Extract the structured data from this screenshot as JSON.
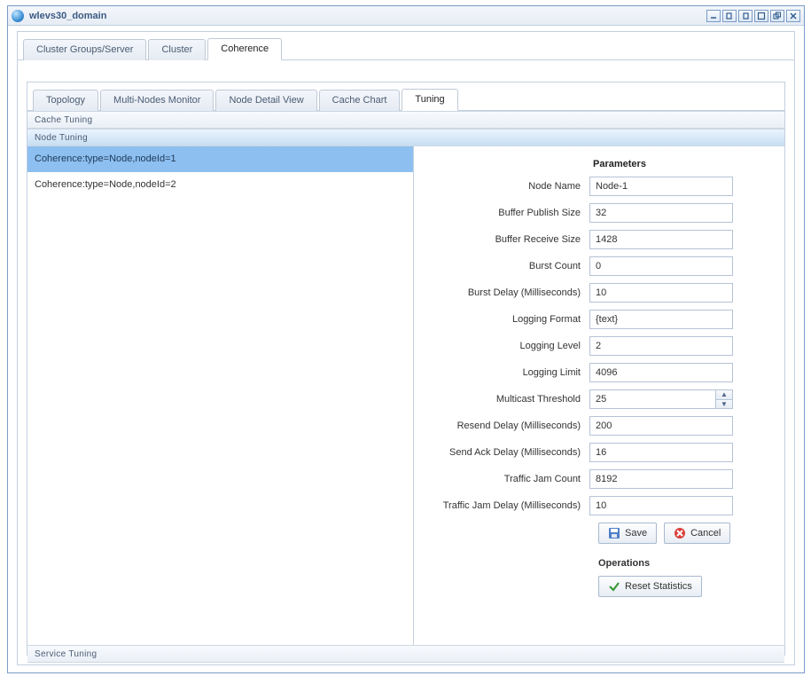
{
  "window": {
    "title": "wlevs30_domain"
  },
  "primary_tabs": [
    {
      "label": "Cluster Groups/Server",
      "active": false
    },
    {
      "label": "Cluster",
      "active": false
    },
    {
      "label": "Coherence",
      "active": true
    }
  ],
  "secondary_tabs": [
    {
      "label": "Topology",
      "active": false
    },
    {
      "label": "Multi-Nodes Monitor",
      "active": false
    },
    {
      "label": "Node Detail View",
      "active": false
    },
    {
      "label": "Cache Chart",
      "active": false
    },
    {
      "label": "Tuning",
      "active": true
    }
  ],
  "accordion": {
    "cache": "Cache Tuning",
    "node": "Node Tuning",
    "service": "Service Tuning"
  },
  "nodes": [
    {
      "label": "Coherence:type=Node,nodeId=1",
      "selected": true
    },
    {
      "label": "Coherence:type=Node,nodeId=2",
      "selected": false
    }
  ],
  "form": {
    "heading": "Parameters",
    "fields": {
      "node_name": {
        "label": "Node Name",
        "value": "Node-1"
      },
      "buffer_publish_size": {
        "label": "Buffer Publish Size",
        "value": "32"
      },
      "buffer_receive_size": {
        "label": "Buffer Receive Size",
        "value": "1428"
      },
      "burst_count": {
        "label": "Burst Count",
        "value": "0"
      },
      "burst_delay": {
        "label": "Burst Delay (Milliseconds)",
        "value": "10"
      },
      "logging_format": {
        "label": "Logging Format",
        "value": "{text}"
      },
      "logging_level": {
        "label": "Logging Level",
        "value": "2"
      },
      "logging_limit": {
        "label": "Logging Limit",
        "value": "4096"
      },
      "multicast_threshold": {
        "label": "Multicast Threshold",
        "value": "25"
      },
      "resend_delay": {
        "label": "Resend Delay (Milliseconds)",
        "value": "200"
      },
      "send_ack_delay": {
        "label": "Send Ack Delay (Milliseconds)",
        "value": "16"
      },
      "traffic_jam_count": {
        "label": "Traffic Jam Count",
        "value": "8192"
      },
      "traffic_jam_delay": {
        "label": "Traffic Jam Delay (Milliseconds)",
        "value": "10"
      }
    },
    "buttons": {
      "save": "Save",
      "cancel": "Cancel"
    },
    "operations": {
      "heading": "Operations",
      "reset": "Reset Statistics"
    }
  }
}
